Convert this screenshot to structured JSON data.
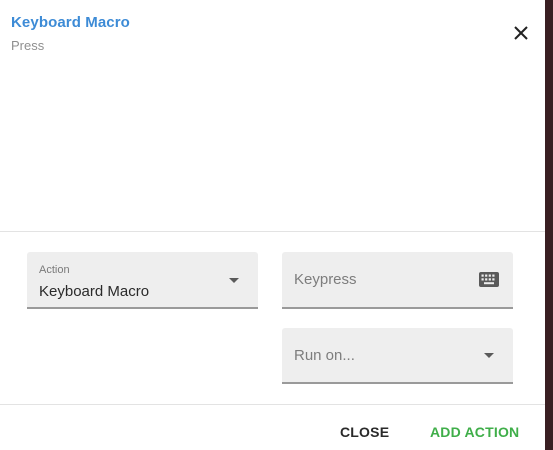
{
  "dialog": {
    "title": "Keyboard Macro",
    "subtitle": "Press",
    "close_icon": "close-icon"
  },
  "form": {
    "action": {
      "label": "Action",
      "value": "Keyboard Macro",
      "icon": "chevron-down-icon"
    },
    "keypress": {
      "placeholder": "Keypress",
      "icon": "keyboard-icon"
    },
    "run_on": {
      "placeholder": "Run on...",
      "icon": "chevron-down-icon"
    }
  },
  "footer": {
    "close_label": "CLOSE",
    "add_label": "ADD ACTION"
  },
  "colors": {
    "title": "#3d8bd6",
    "add_button": "#3fae49",
    "field_bg": "#eeeeee",
    "right_edge": "#3a1f22"
  }
}
